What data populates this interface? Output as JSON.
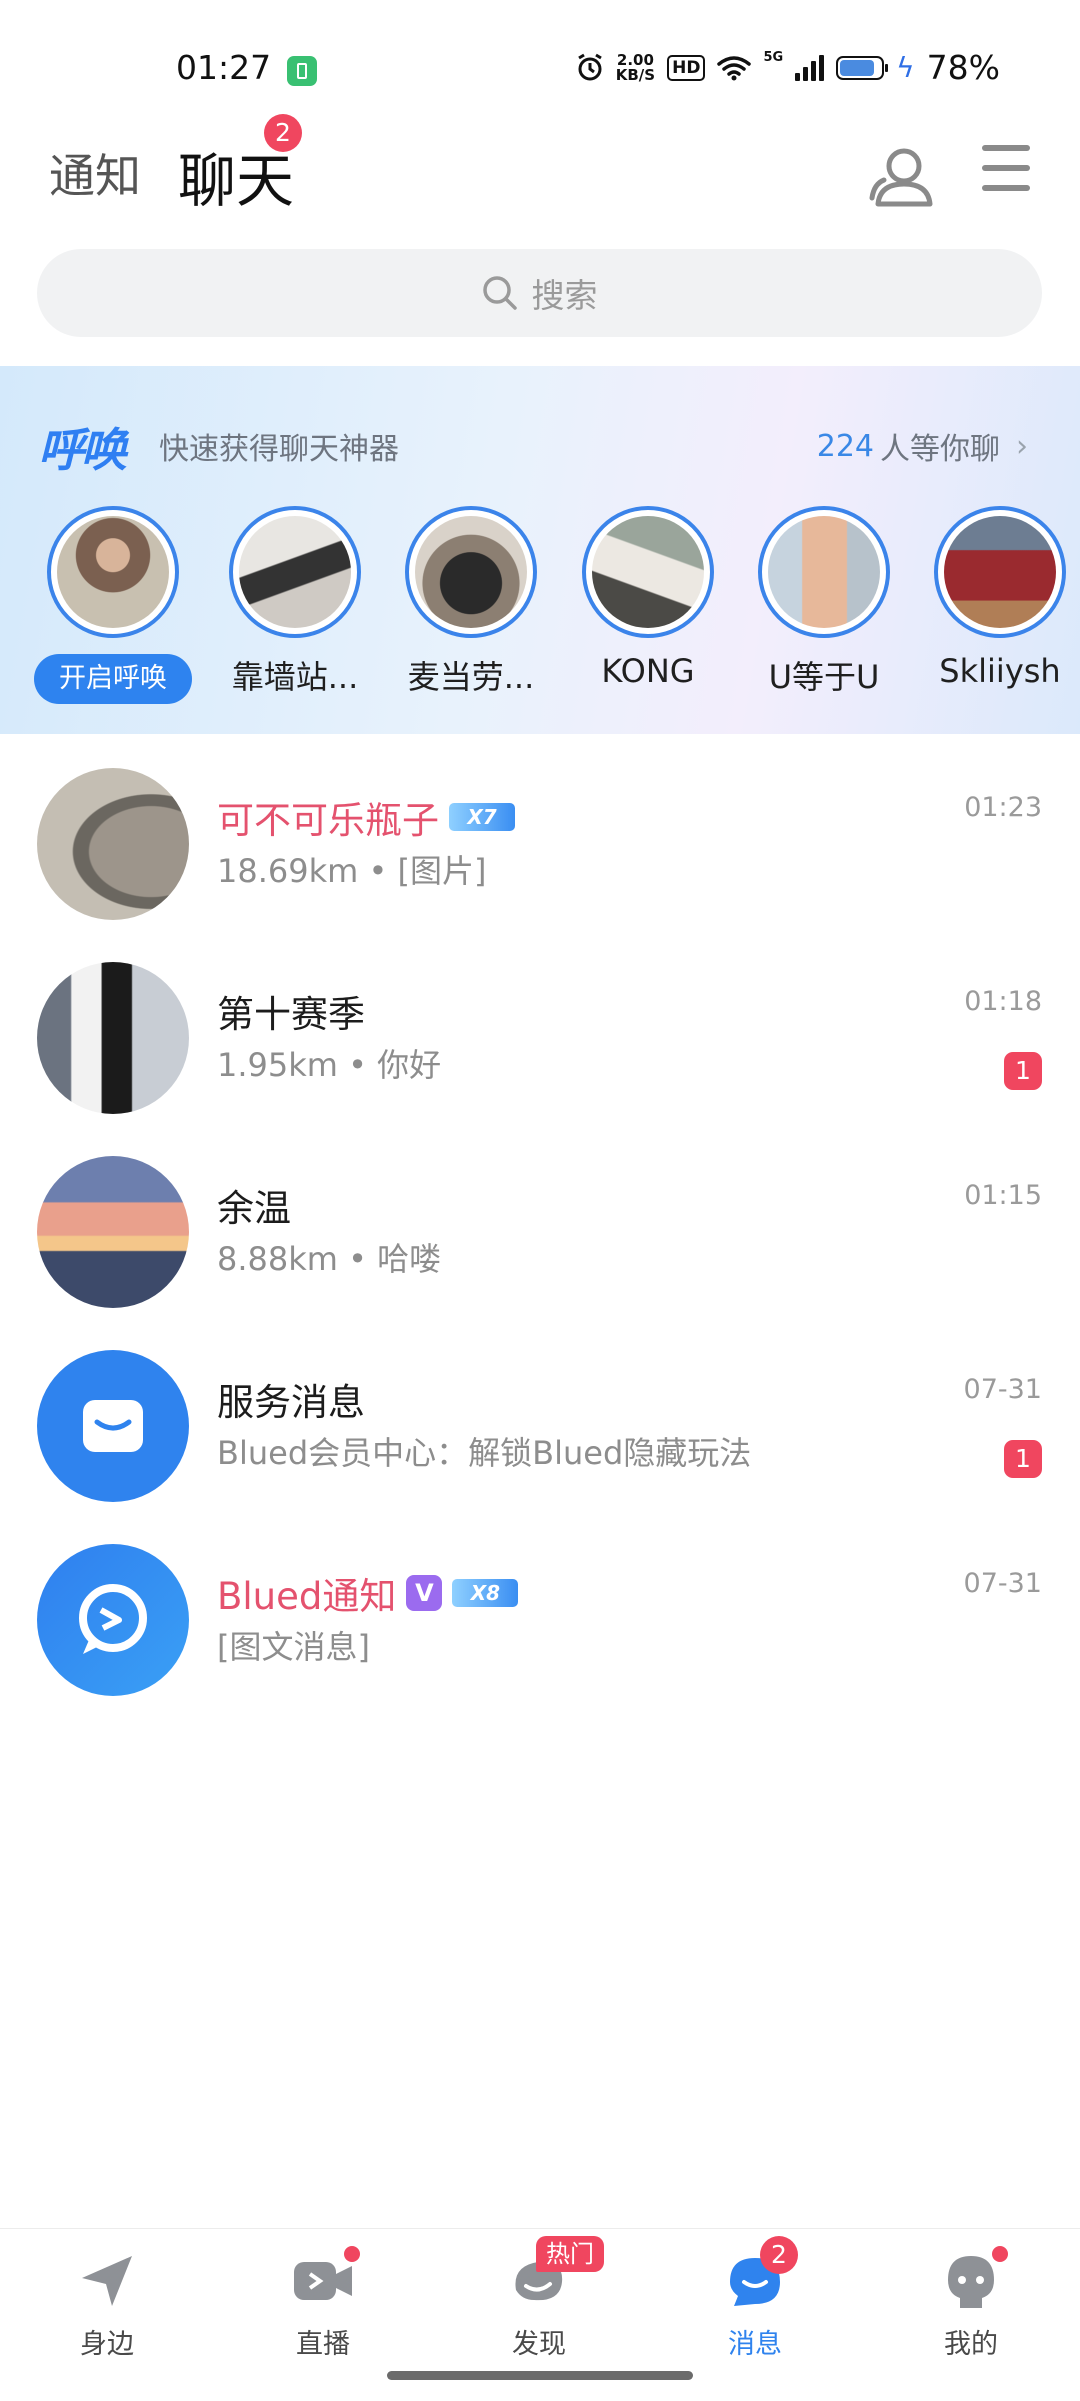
{
  "status_bar": {
    "time": "01:27",
    "net_speed_value": "2.00",
    "net_speed_unit": "KB/S",
    "hd": "HD",
    "network": "5G",
    "battery": "78%",
    "battery_level": 0.78,
    "icons": [
      "app-battery-icon",
      "alarm-icon",
      "wifi-icon",
      "signal-icon",
      "battery-icon",
      "charging-icon"
    ]
  },
  "header": {
    "tabs": [
      {
        "label": "通知",
        "active": false
      },
      {
        "label": "聊天",
        "active": true,
        "badge": "2"
      }
    ],
    "icons": [
      "contacts-icon",
      "menu-icon"
    ]
  },
  "search": {
    "placeholder": "搜索",
    "icon": "search-icon"
  },
  "summon": {
    "logo": "呼唤",
    "subtitle": "快速获得聊天神器",
    "count": "224",
    "count_suffix": "人等你聊",
    "chevron": "›",
    "start_label": "开启呼唤",
    "stories": [
      {
        "name": ""
      },
      {
        "name": "靠墙站..."
      },
      {
        "name": "麦当劳..."
      },
      {
        "name": "KONG"
      },
      {
        "name": "U等于U"
      },
      {
        "name": "Skliiysh"
      }
    ]
  },
  "chats": [
    {
      "name": "可不可乐瓶子",
      "preview": "18.69km • [图片]",
      "time": "01:23",
      "unread": "",
      "vip": "7",
      "verified": false,
      "highlight": true
    },
    {
      "name": "第十赛季",
      "preview": "1.95km • 你好",
      "time": "01:18",
      "unread": "1",
      "vip": "",
      "verified": false,
      "highlight": false
    },
    {
      "name": "余温",
      "preview": "8.88km • 哈喽",
      "time": "01:15",
      "unread": "",
      "vip": "",
      "verified": false,
      "highlight": false
    },
    {
      "name": "服务消息",
      "preview": "Blued会员中心：解锁Blued隐藏玩法",
      "time": "07-31",
      "unread": "1",
      "vip": "",
      "verified": false,
      "highlight": false
    },
    {
      "name": "Blued通知",
      "preview": "[图文消息]",
      "time": "07-31",
      "unread": "",
      "vip": "8",
      "verified": true,
      "verified_label": "V",
      "highlight": true
    }
  ],
  "bottom_nav": [
    {
      "label": "身边",
      "icon": "nearby-icon",
      "active": false
    },
    {
      "label": "直播",
      "icon": "live-icon",
      "active": false,
      "dot": true
    },
    {
      "label": "发现",
      "icon": "discover-icon",
      "active": false,
      "hot": "热门"
    },
    {
      "label": "消息",
      "icon": "message-icon",
      "active": true,
      "badge": "2"
    },
    {
      "label": "我的",
      "icon": "profile-icon",
      "active": false,
      "dot": true
    }
  ],
  "colors": {
    "accent": "#2f83ee",
    "badge": "#f0465f",
    "highlight_name": "#e4526e",
    "vip_badge": "#3a8ef2",
    "verified": "#9b6bef"
  }
}
